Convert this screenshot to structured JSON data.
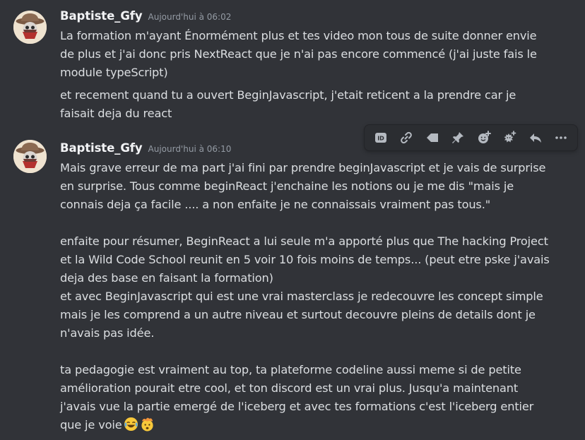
{
  "messages": [
    {
      "author": "Baptiste_Gfy",
      "timestamp": "Aujourd'hui à 06:02",
      "paragraphs": [
        [
          "La formation m'ayant Énormément plus et tes video mon tous de suite donner envie",
          "de plus et j'ai donc pris NextReact que je n'ai pas encore commencé (j'ai juste fais le",
          "module typeScript)"
        ],
        [
          "et recement quand tu a ouvert BeginJavascript, j'etait reticent a la prendre car je",
          "faisait deja du react"
        ]
      ]
    },
    {
      "author": "Baptiste_Gfy",
      "timestamp": "Aujourd'hui à 06:10",
      "paragraphs": [
        [
          "Mais grave erreur de ma part j'ai fini par prendre beginJavascript et je vais de surprise",
          "en surprise. Tous comme beginReact j'enchaine les notions ou je me dis \"mais je",
          "connais deja ça facile .... a non enfaite je ne connaissais vraiment pas tous.\""
        ],
        [
          "enfaite pour résumer, BeginReact a lui seule m'a apporté plus que The hacking Project",
          "et la Wild Code School reunit en 5 voir 10 fois moins de temps... (peut etre pske j'avais",
          "deja des base en faisant la formation)",
          "et avec BeginJavascript qui est une vrai masterclass je redecouvre les concept simple",
          "mais je les comprend a un autre niveau et surtout decouvre pleins de details dont je",
          "n'avais pas idée."
        ],
        [
          "ta pedagogie est vraiment au top, ta plateforme codeline aussi meme si de petite",
          "amélioration pourait etre cool, et ton discord est un vrai plus. Jusqu'a maintenant",
          "j'avais vue la partie emergé de l'iceberg et avec tes formations c'est l'iceberg entier",
          "que je voie"
        ]
      ],
      "trailing_emojis": [
        "joy-emoji",
        "exploding-head-emoji"
      ]
    }
  ],
  "toolbar": {
    "icons": [
      "id-icon",
      "link-icon",
      "tag-icon",
      "pin-icon",
      "add-reaction-icon",
      "add-super-reaction-icon",
      "reply-icon",
      "more-icon"
    ]
  },
  "colors": {
    "background": "#313338",
    "text": "#dbdee1",
    "username": "#f2f3f5",
    "timestamp": "#949ba4",
    "toolbar_bg": "#2b2d31",
    "icon": "#b5bac1"
  }
}
